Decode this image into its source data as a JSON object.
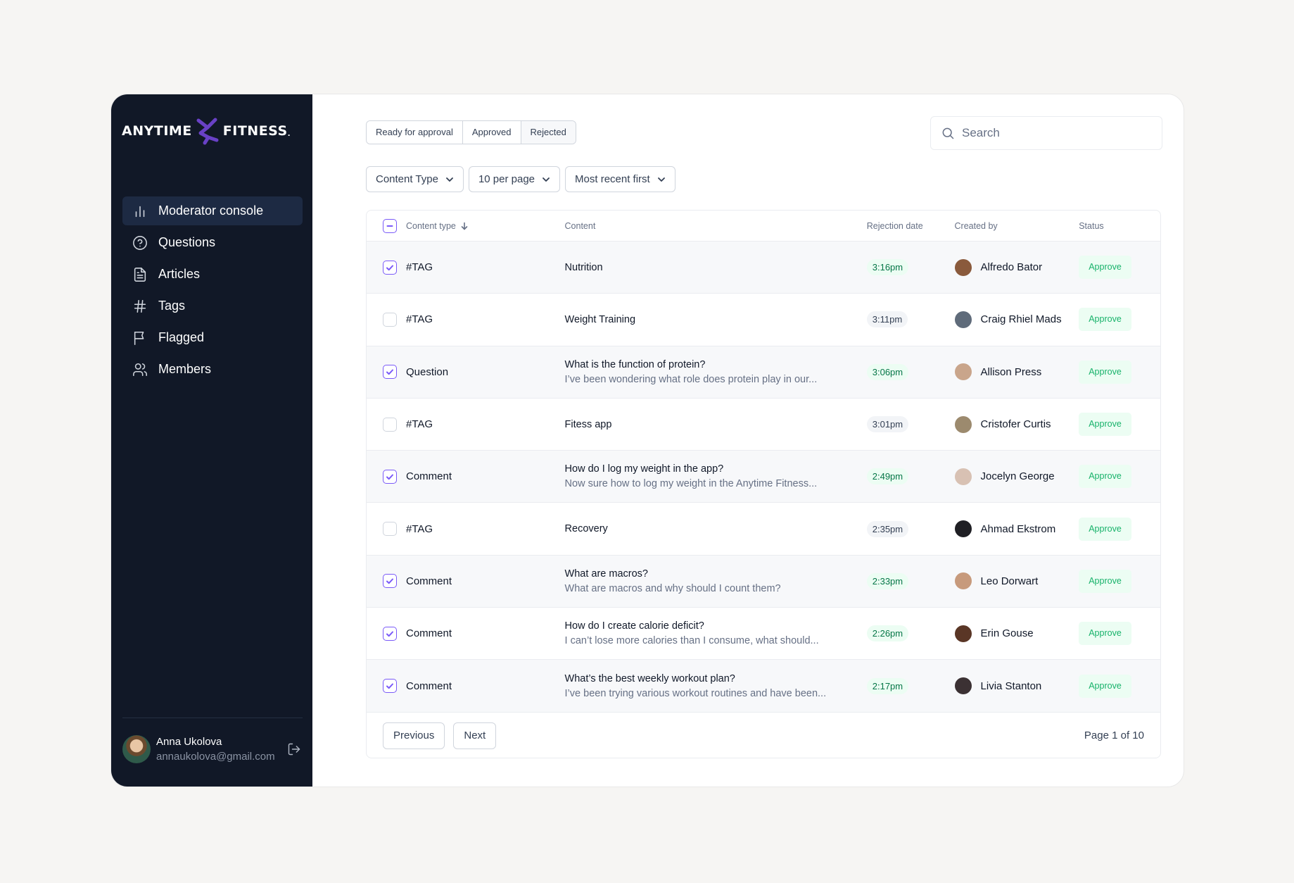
{
  "brand": {
    "left_word": "ANYTIME",
    "right_word": "FITNESS",
    "mark_suffix": ".",
    "accent_color": "#6941c6"
  },
  "nav": {
    "items": [
      {
        "label": "Moderator console",
        "icon": "bar-chart-icon",
        "active": true
      },
      {
        "label": "Questions",
        "icon": "help-circle-icon"
      },
      {
        "label": "Articles",
        "icon": "file-text-icon"
      },
      {
        "label": "Tags",
        "icon": "hash-icon"
      },
      {
        "label": "Flagged",
        "icon": "flag-icon"
      },
      {
        "label": "Members",
        "icon": "users-icon"
      }
    ]
  },
  "user": {
    "name": "Anna Ukolova",
    "email": "annaukolova@gmail.com"
  },
  "tabs": [
    {
      "label": "Ready for approval"
    },
    {
      "label": "Approved"
    },
    {
      "label": "Rejected",
      "active": true
    }
  ],
  "search": {
    "placeholder": "Search"
  },
  "filters": {
    "content_type": "Content Type",
    "per_page": "10 per page",
    "sort": "Most recent first"
  },
  "table": {
    "headers": {
      "type": "Content type",
      "content": "Content",
      "date": "Rejection date",
      "creator": "Created by",
      "status": "Status"
    },
    "rows": [
      {
        "checked": true,
        "type": "#TAG",
        "title": "Nutrition",
        "subtitle": "",
        "time": "3:16pm",
        "time_style": "green",
        "creator": "Alfredo Bator",
        "status": "Approve",
        "avatar_color": "#8a5a3c"
      },
      {
        "checked": false,
        "type": "#TAG",
        "title": "Weight Training",
        "subtitle": "",
        "time": "3:11pm",
        "time_style": "neutral",
        "creator": "Craig Rhiel Mads",
        "status": "Approve",
        "avatar_color": "#5f6b7a"
      },
      {
        "checked": true,
        "type": "Question",
        "title": "What is the function of protein?",
        "subtitle": "I’ve been wondering what role does protein play in our...",
        "time": "3:06pm",
        "time_style": "green",
        "creator": "Allison Press",
        "status": "Approve",
        "avatar_color": "#c9a58b"
      },
      {
        "checked": false,
        "type": "#TAG",
        "title": "Fitess app",
        "subtitle": "",
        "time": "3:01pm",
        "time_style": "neutral",
        "creator": "Cristofer Curtis",
        "status": "Approve",
        "avatar_color": "#9c8a6e"
      },
      {
        "checked": true,
        "type": "Comment",
        "title": "How do I log my weight in the app?",
        "subtitle": "Now sure how to log my weight in the Anytime Fitness...",
        "time": "2:49pm",
        "time_style": "green",
        "creator": "Jocelyn George",
        "status": "Approve",
        "avatar_color": "#d8c1b3"
      },
      {
        "checked": false,
        "type": "#TAG",
        "title": "Recovery",
        "subtitle": "",
        "time": "2:35pm",
        "time_style": "neutral",
        "creator": "Ahmad Ekstrom",
        "status": "Approve",
        "avatar_color": "#1f1f24"
      },
      {
        "checked": true,
        "type": "Comment",
        "title": "What are macros?",
        "subtitle": "What are macros and why should I count them?",
        "time": "2:33pm",
        "time_style": "green",
        "creator": "Leo Dorwart",
        "status": "Approve",
        "avatar_color": "#c79a7c"
      },
      {
        "checked": true,
        "type": "Comment",
        "title": "How do I create calorie deficit?",
        "subtitle": "I can’t lose more calories than I consume, what should...",
        "time": "2:26pm",
        "time_style": "green",
        "creator": "Erin Gouse",
        "status": "Approve",
        "avatar_color": "#5a3626"
      },
      {
        "checked": true,
        "type": "Comment",
        "title": "What’s the best weekly workout plan?",
        "subtitle": "I’ve been trying various workout routines and have been...",
        "time": "2:17pm",
        "time_style": "green",
        "creator": "Livia Stanton",
        "status": "Approve",
        "avatar_color": "#3b3133"
      }
    ]
  },
  "pagination": {
    "previous": "Previous",
    "next": "Next",
    "info": "Page 1 of 10"
  }
}
